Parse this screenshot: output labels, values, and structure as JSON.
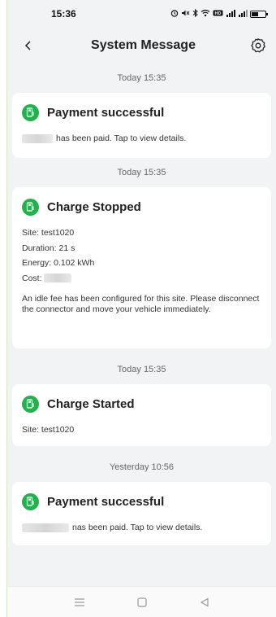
{
  "status_bar": {
    "time": "15:36",
    "icons": [
      "alarm-icon",
      "mute-icon",
      "bluetooth-icon",
      "wifi-icon",
      "hd-icon",
      "signal-icon",
      "signal-icon",
      "battery-icon"
    ],
    "hd_label": "HD"
  },
  "header": {
    "title": "System Message"
  },
  "messages": [
    {
      "timestamp": "Today 15:35",
      "title": "Payment successful",
      "body": "has been paid. Tap to view details."
    },
    {
      "timestamp": "Today 15:35",
      "title": "Charge Stopped",
      "lines": {
        "site": "Site: test1020",
        "duration": "Duration: 21 s",
        "energy": "Energy: 0.102 kWh",
        "cost": "Cost:"
      },
      "note": "An idle fee has been configured for this site. Please disconnect the connector and move your vehicle immediately."
    },
    {
      "timestamp": "Today 15:35",
      "title": "Charge Started",
      "lines": {
        "site": "Site: test1020"
      }
    },
    {
      "timestamp": "Yesterday 10:56",
      "title": "Payment successful",
      "body": "nas been paid. Tap to view details."
    }
  ],
  "colors": {
    "accent": "#22b14c",
    "background": "#f2f3f5",
    "card": "#ffffff"
  }
}
